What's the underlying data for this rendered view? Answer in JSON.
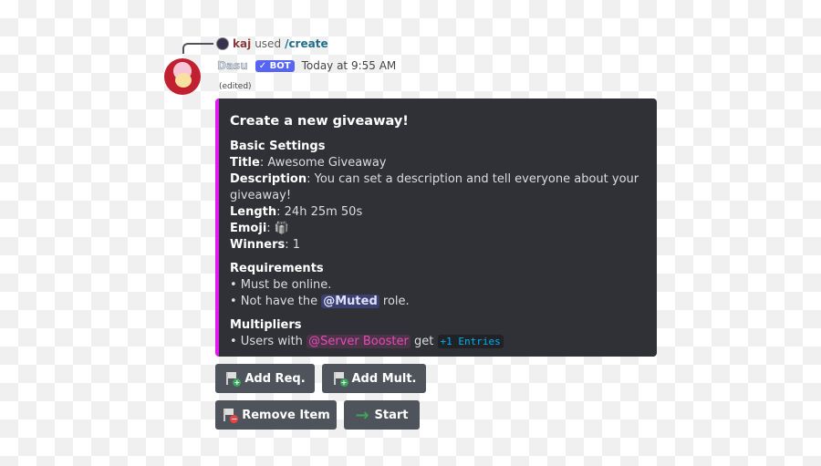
{
  "reply": {
    "user": "kaj",
    "used": "used",
    "command": "/create"
  },
  "message": {
    "author": "Dasu",
    "badge": "✓ BOT",
    "timestamp": "Today at 9:55 AM",
    "edited": "(edited)"
  },
  "embed": {
    "accent": "#e01bf0",
    "title": "Create a new giveaway!",
    "basic": {
      "heading": "Basic Settings",
      "title_label": "Title",
      "title_value": ": Awesome Giveaway",
      "desc_label": "Description",
      "desc_value": ": You can set a description and tell everyone about your giveaway!",
      "length_label": "Length",
      "length_value": ": 24h 25m 50s",
      "emoji_label": "Emoji",
      "emoji_value": ": 🎁",
      "winners_label": "Winners",
      "winners_value": ": 1"
    },
    "requirements": {
      "heading": "Requirements",
      "item1": "• Must be online.",
      "item2_pre": "• Not have the ",
      "item2_role": "@Muted",
      "item2_post": " role."
    },
    "multipliers": {
      "heading": "Multipliers",
      "item1_pre": "• Users with ",
      "item1_role": "@Server Booster",
      "item1_mid": " get ",
      "item1_code": "+1 Entries"
    }
  },
  "buttons": {
    "add_req": "Add Req.",
    "add_mult": "Add Mult.",
    "remove_item": "Remove Item",
    "start": "Start"
  }
}
